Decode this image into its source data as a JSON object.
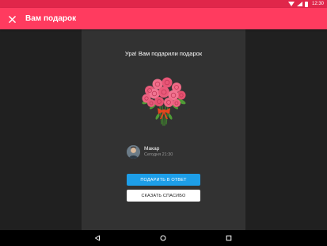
{
  "status_bar": {
    "time": "12:30",
    "icons": [
      "wifi-icon",
      "signal-icon",
      "battery-icon"
    ],
    "color": "#e0264a"
  },
  "app_bar": {
    "title": "Вам подарок",
    "close_icon": "close-icon",
    "color": "#ff3b5f"
  },
  "gift": {
    "headline": "Ура! Вам подарили подарок",
    "image": "rose-bouquet"
  },
  "sender": {
    "name": "Макар",
    "time": "Сегодня 21:30"
  },
  "actions": {
    "reply_gift_label": "ПОДАРИТЬ В ОТВЕТ",
    "thanks_label": "СКАЗАТЬ СПАСИБО",
    "primary_color": "#1d9ee8"
  },
  "nav_bar": {
    "icons": [
      "back-icon",
      "home-icon",
      "recents-icon"
    ]
  }
}
